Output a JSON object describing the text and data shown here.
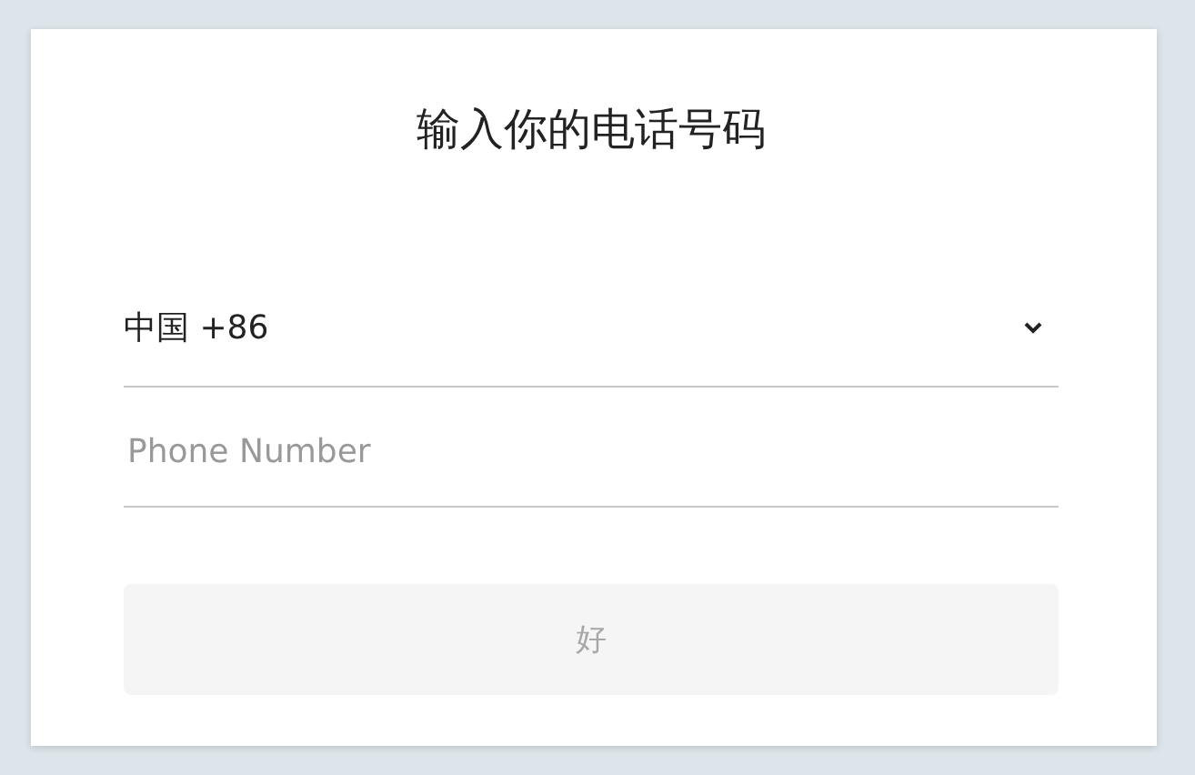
{
  "dialog": {
    "title": "输入你的电话号码",
    "country_select": {
      "value": "中国 +86"
    },
    "phone_field": {
      "placeholder": "Phone Number"
    },
    "confirm_button": {
      "label": "好",
      "disabled": true
    }
  }
}
